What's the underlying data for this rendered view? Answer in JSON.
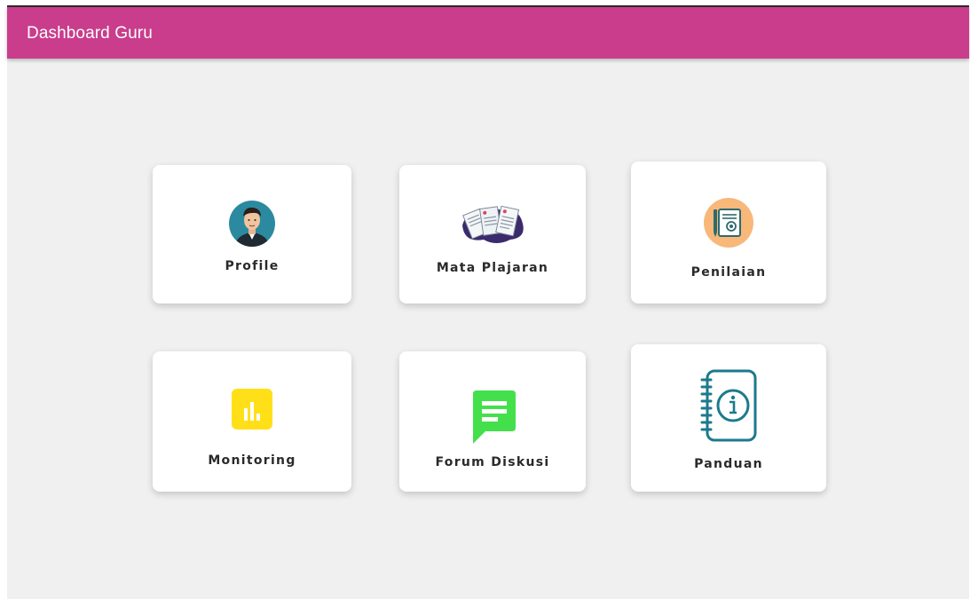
{
  "appbar": {
    "title": "Dashboard Guru",
    "color": "#c93d8c"
  },
  "menu": [
    {
      "label": "Profile",
      "icon": "avatar-icon"
    },
    {
      "label": "Mata Plajaran",
      "icon": "documents-icon"
    },
    {
      "label": "Penilaian",
      "icon": "certificate-icon"
    },
    {
      "label": "Monitoring",
      "icon": "bar-chart-icon"
    },
    {
      "label": "Forum Diskusi",
      "icon": "chat-icon"
    },
    {
      "label": "Panduan",
      "icon": "info-notebook-icon"
    }
  ]
}
